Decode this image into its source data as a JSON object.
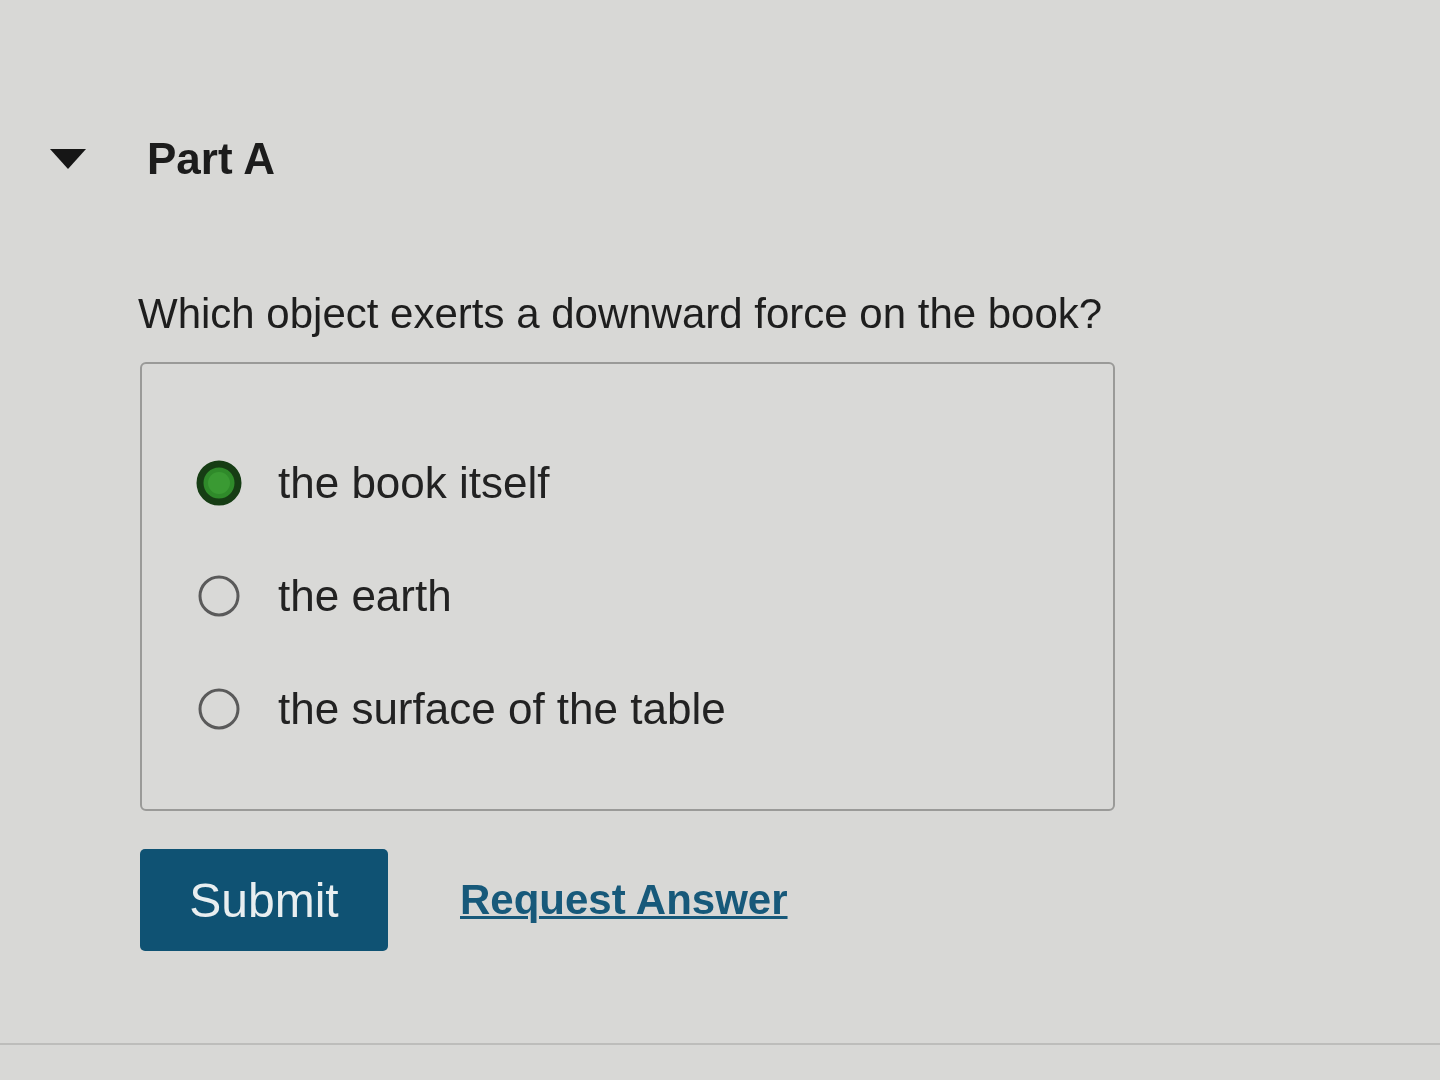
{
  "part": {
    "title": "Part A",
    "expanded": true
  },
  "question": "Which object exerts a downward force on the book?",
  "options": [
    {
      "label": "the book itself",
      "selected": true
    },
    {
      "label": "the earth",
      "selected": false
    },
    {
      "label": "the surface of the table",
      "selected": false
    }
  ],
  "actions": [
    {
      "kind": "primary",
      "label": "Submit"
    },
    {
      "kind": "link",
      "label": "Request Answer"
    }
  ]
}
